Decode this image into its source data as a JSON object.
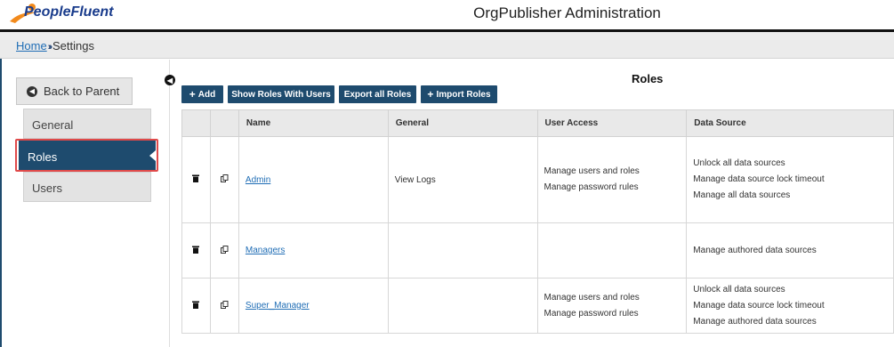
{
  "header": {
    "logo_text": "PeopleFluent",
    "app_title": "OrgPublisher Administration"
  },
  "breadcrumb": {
    "home": "Home",
    "separator": "››",
    "current": "Settings"
  },
  "sidebar": {
    "back_label": "Back to Parent",
    "items": [
      {
        "label": "General"
      },
      {
        "label": "Roles"
      },
      {
        "label": "Users"
      }
    ]
  },
  "main": {
    "title": "Roles",
    "toolbar": {
      "add": "Add",
      "show_roles": "Show Roles With Users",
      "export": "Export all Roles",
      "import": "Import Roles"
    },
    "table": {
      "columns": [
        "Name",
        "General",
        "User Access",
        "Data Source"
      ],
      "rows": [
        {
          "name": "Admin",
          "general": "View Logs",
          "user_access": [
            "Manage users and roles",
            "Manage password rules"
          ],
          "data_source": [
            "Unlock all data sources",
            "Manage data source lock timeout",
            "Manage all data sources"
          ]
        },
        {
          "name": "Managers",
          "general": "",
          "user_access": [],
          "data_source": [
            "Manage authored data sources"
          ]
        },
        {
          "name": "Super_Manager",
          "general": "",
          "user_access": [
            "Manage users and roles",
            "Manage password rules"
          ],
          "data_source": [
            "Unlock all data sources",
            "Manage data source lock timeout",
            "Manage authored data sources"
          ]
        }
      ]
    }
  },
  "colors": {
    "accent": "#1e4b6e",
    "highlight": "#e04a4a",
    "link": "#1f6db5",
    "logo_orange": "#f28a1c",
    "logo_blue": "#1a3c8c"
  }
}
